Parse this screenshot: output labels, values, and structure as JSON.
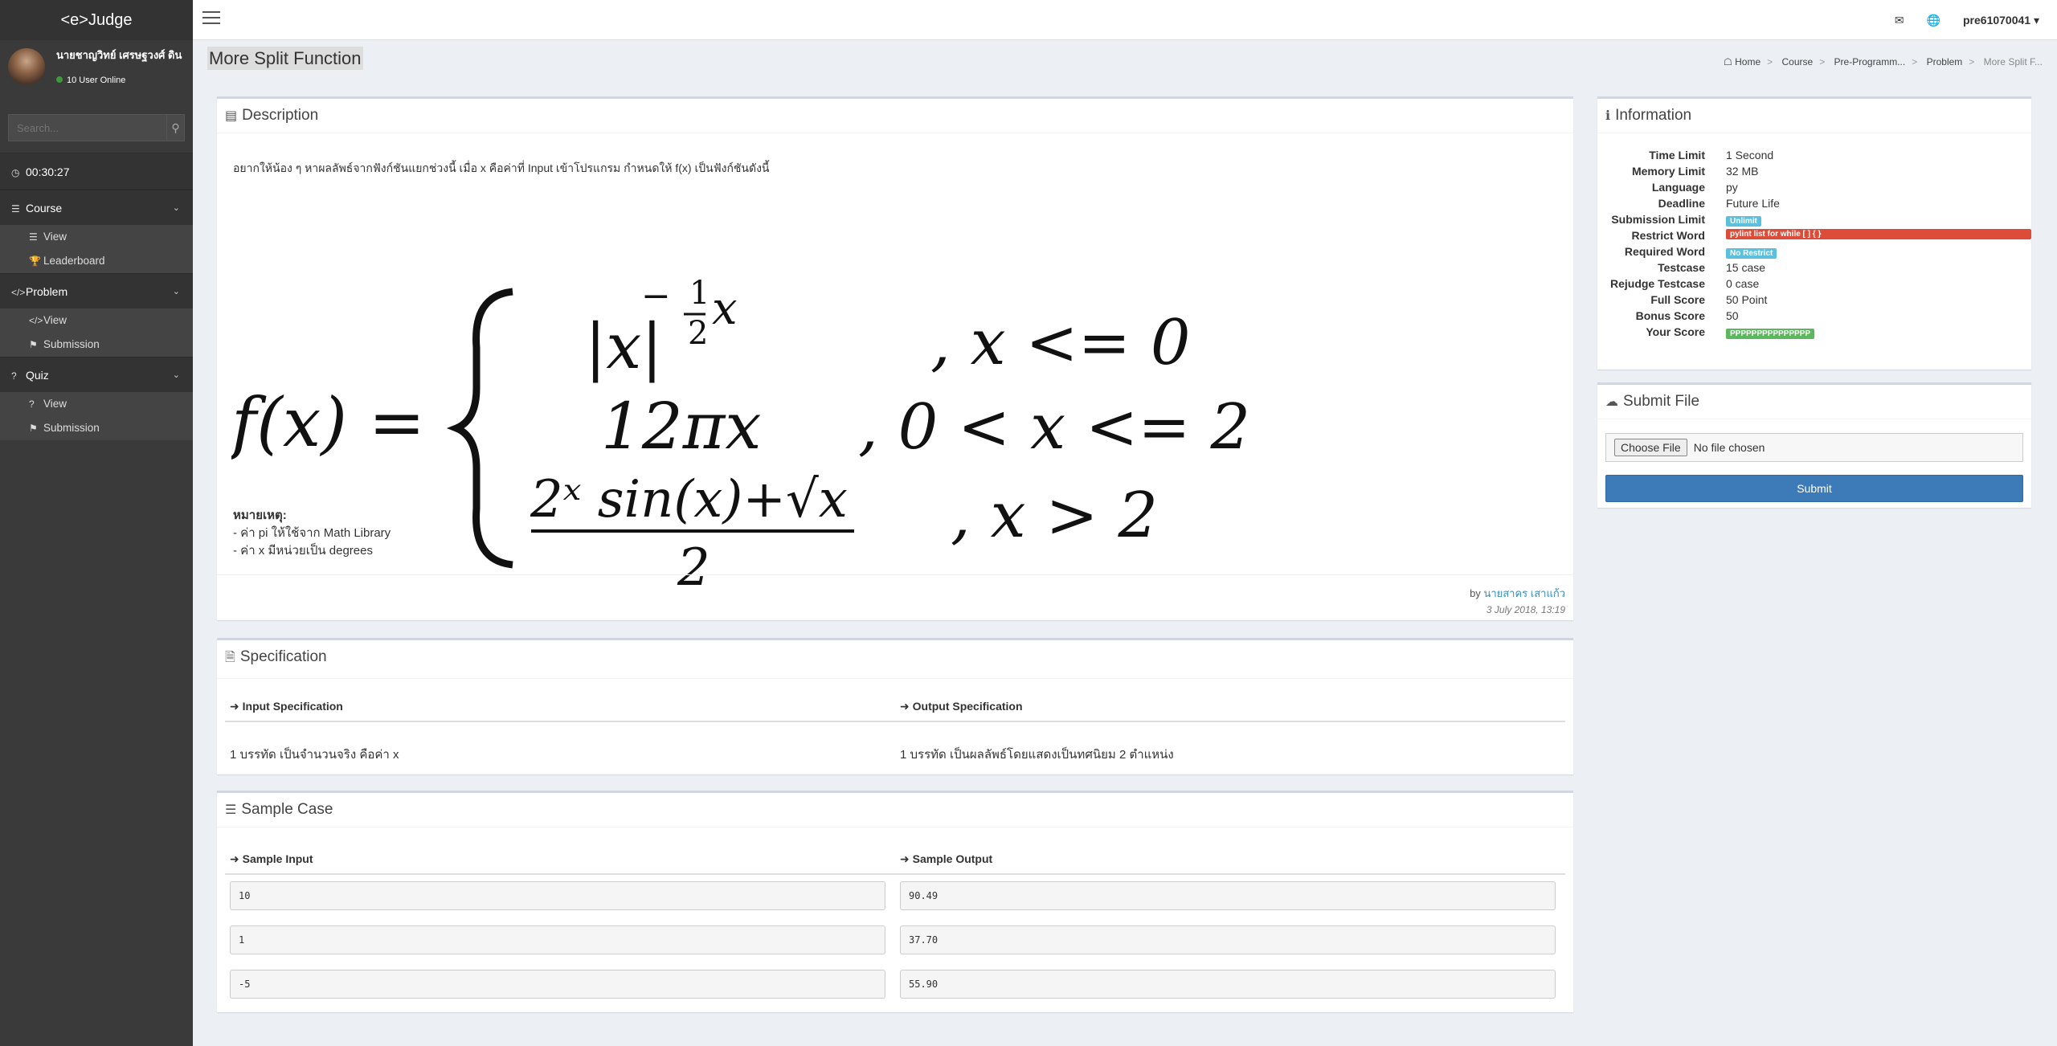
{
  "app": {
    "logo": "<e>Judge"
  },
  "user": {
    "name": "นายชาญวิทย์ เศรษฐวงศ์ ดิน",
    "online": "10 User Online"
  },
  "search": {
    "placeholder": "Search..."
  },
  "timer": "00:30:27",
  "sidebar": {
    "sections": [
      {
        "label": "Course",
        "items": [
          "View",
          "Leaderboard"
        ]
      },
      {
        "label": "Problem",
        "items": [
          "View",
          "Submission"
        ]
      },
      {
        "label": "Quiz",
        "items": [
          "View",
          "Submission"
        ]
      }
    ]
  },
  "topbar": {
    "username": "pre61070041"
  },
  "page": {
    "title": "More Split Function"
  },
  "breadcrumb": [
    "Home",
    "Course",
    "Pre-Programm...",
    "Problem",
    "More Split F..."
  ],
  "description": {
    "title": "Description",
    "intro": "อยากให้น้อง ๆ หาผลลัพธ์จากฟังก์ชันแยกช่วงนี้ เมื่อ x คือค่าที่ Input เข้าโปรแกรม กำหนดให้ f(x) เป็นฟังก์ชันดังนี้",
    "formula": {
      "lhs": "f(x) =",
      "case1_expr": "|x|",
      "case1_exp_num": "1",
      "case1_exp_den": "2",
      "case1_exp_var": "x",
      "case1_cond": ", x <= 0",
      "case2_expr": "12πx",
      "case2_cond": ", 0 < x <= 2",
      "case3_num": "2ˣ sin(x)+√x",
      "case3_den": "2",
      "case3_cond": ", x > 2"
    },
    "note_title": "หมายเหตุ:",
    "notes": [
      "- ค่า pi ให้ใช้จาก Math Library",
      "- ค่า x มีหน่วยเป็น degrees"
    ],
    "by": "by",
    "author": "นายสาคร เสาแก้ว",
    "date": "3 July 2018, 13:19"
  },
  "specification": {
    "title": "Specification",
    "input_head": "Input Specification",
    "output_head": "Output Specification",
    "input_text": "1 บรรทัด เป็นจำนวนจริง คือค่า x",
    "output_text": "1 บรรทัด เป็นผลลัพธ์โดยแสดงเป็นทศนิยม 2 ตำแหน่ง"
  },
  "sample": {
    "title": "Sample Case",
    "input_head": "Sample Input",
    "output_head": "Sample Output",
    "cases": [
      {
        "input": "10",
        "output": "90.49"
      },
      {
        "input": "1",
        "output": "37.70"
      },
      {
        "input": "-5",
        "output": "55.90"
      }
    ]
  },
  "information": {
    "title": "Information",
    "time_limit_label": "Time Limit",
    "time_limit": "1 Second",
    "memory_limit_label": "Memory Limit",
    "memory_limit": "32 MB",
    "language_label": "Language",
    "language": "py",
    "deadline_label": "Deadline",
    "deadline": "Future Life",
    "submission_limit_label": "Submission Limit",
    "submission_limit": "Unlimit",
    "restrict_word_label": "Restrict Word",
    "restrict_word": "pylint list for while [ ] { }",
    "required_word_label": "Required Word",
    "required_word": "No Restrict",
    "testcase_label": "Testcase",
    "testcase": "15 case",
    "rejudge_label": "Rejudge Testcase",
    "rejudge": "0 case",
    "full_score_label": "Full Score",
    "full_score": "50 Point",
    "bonus_score_label": "Bonus Score",
    "bonus_score": "50",
    "your_score_label": "Your Score",
    "your_score": "PPPPPPPPPPPPPPP"
  },
  "submit_file": {
    "title": "Submit File",
    "choose_label": "Choose File",
    "no_file": "No file chosen",
    "submit_label": "Submit"
  },
  "colors": {
    "restrict": "#dd4b39",
    "info_badge": "#5bc0de",
    "success": "#5cb85c",
    "submit": "#3c7ab8"
  }
}
